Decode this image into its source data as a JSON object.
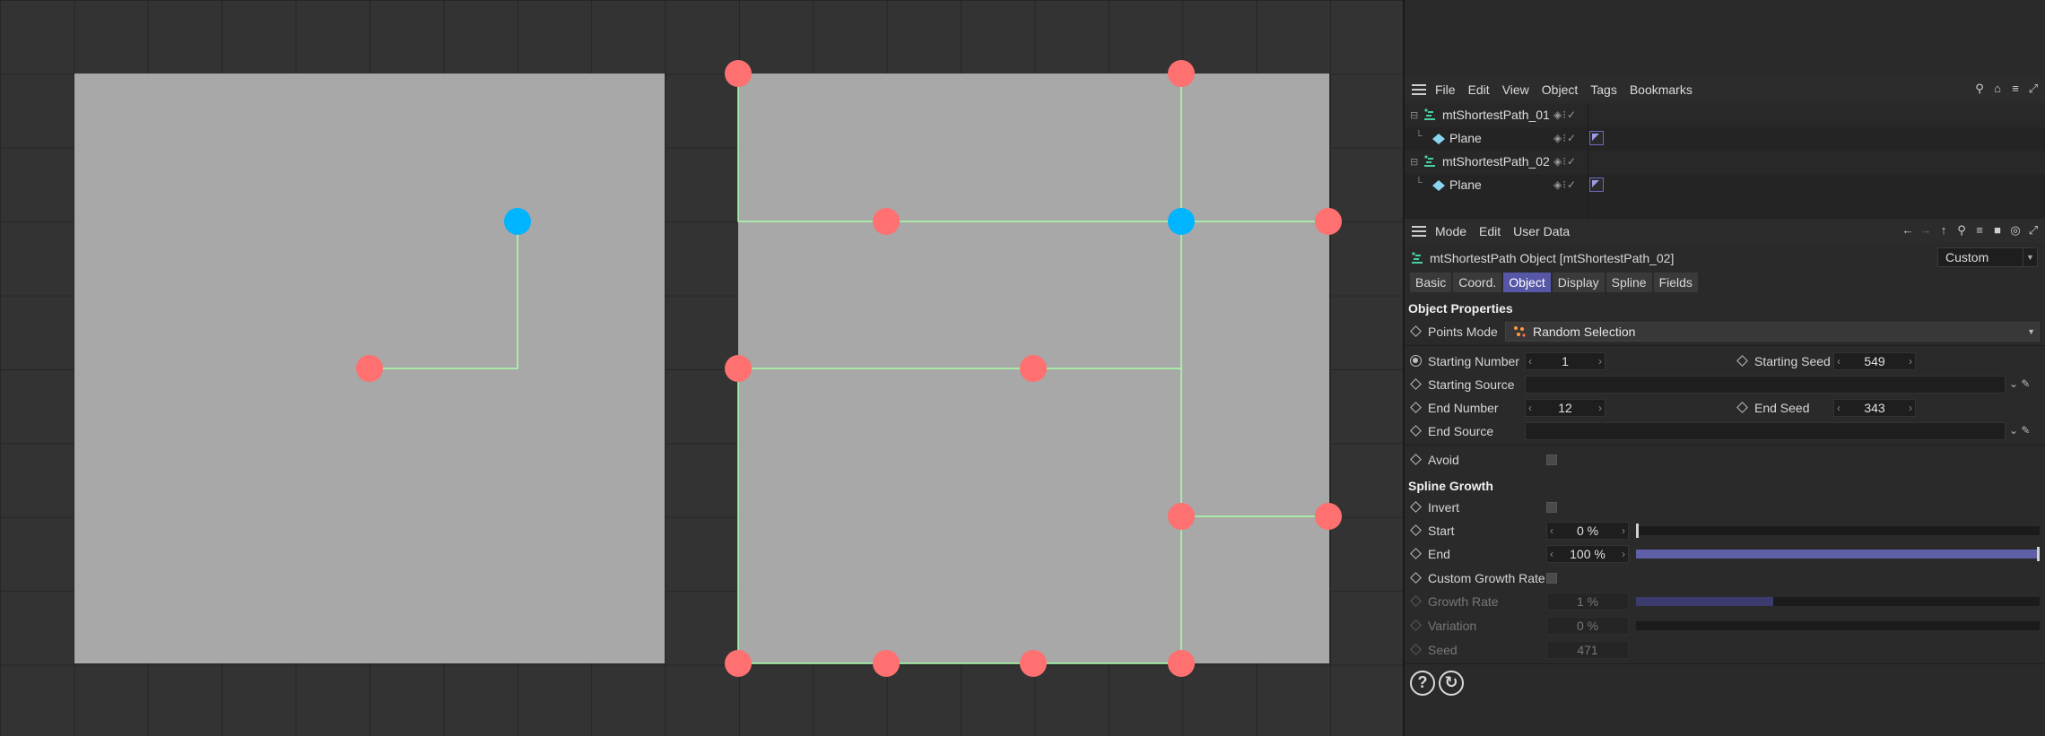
{
  "object_manager": {
    "menu": [
      "File",
      "Edit",
      "View",
      "Object",
      "Tags",
      "Bookmarks"
    ],
    "tool_icons": [
      "search-icon",
      "home-icon",
      "filter-icon",
      "popout-icon"
    ],
    "objects": [
      {
        "name": "mtShortestPath_01",
        "icon": "shortest-path-icon",
        "level": 0
      },
      {
        "name": "Plane",
        "icon": "plane-icon",
        "level": 1
      },
      {
        "name": "mtShortestPath_02",
        "icon": "shortest-path-icon",
        "level": 0
      },
      {
        "name": "Plane",
        "icon": "plane-icon",
        "level": 1
      }
    ]
  },
  "attribute_manager": {
    "menu": [
      "Mode",
      "Edit",
      "User Data"
    ],
    "title": "mtShortestPath Object [mtShortestPath_02]",
    "preset": "Custom",
    "tabs": [
      "Basic",
      "Coord.",
      "Object",
      "Display",
      "Spline",
      "Fields"
    ],
    "active_tab": "Object",
    "object_properties": {
      "heading": "Object Properties",
      "points_mode_label": "Points Mode",
      "points_mode_value": "Random Selection",
      "starting_number_label": "Starting Number",
      "starting_number": "1",
      "starting_seed_label": "Starting Seed",
      "starting_seed": "549",
      "starting_source_label": "Starting Source",
      "end_number_label": "End Number",
      "end_number": "12",
      "end_seed_label": "End Seed",
      "end_seed": "343",
      "end_source_label": "End Source",
      "avoid_label": "Avoid"
    },
    "spline_growth": {
      "heading": "Spline Growth",
      "invert_label": "Invert",
      "start_label": "Start",
      "start_value": "0 %",
      "start_fraction": 0.0,
      "end_label": "End",
      "end_value": "100 %",
      "end_fraction": 1.0,
      "custom_growth_rate_label": "Custom Growth Rate",
      "growth_rate_label": "Growth Rate",
      "growth_rate_value": "1 %",
      "growth_rate_fraction": 0.34,
      "variation_label": "Variation",
      "variation_value": "0 %",
      "seed_label": "Seed",
      "seed_value": "471"
    }
  },
  "colors": {
    "accent": "#5757a8",
    "point_red": "#ff7070",
    "point_blue": "#00b4ff",
    "path_green": "#a8ffa8",
    "plane_gray": "#a8a8a8"
  }
}
